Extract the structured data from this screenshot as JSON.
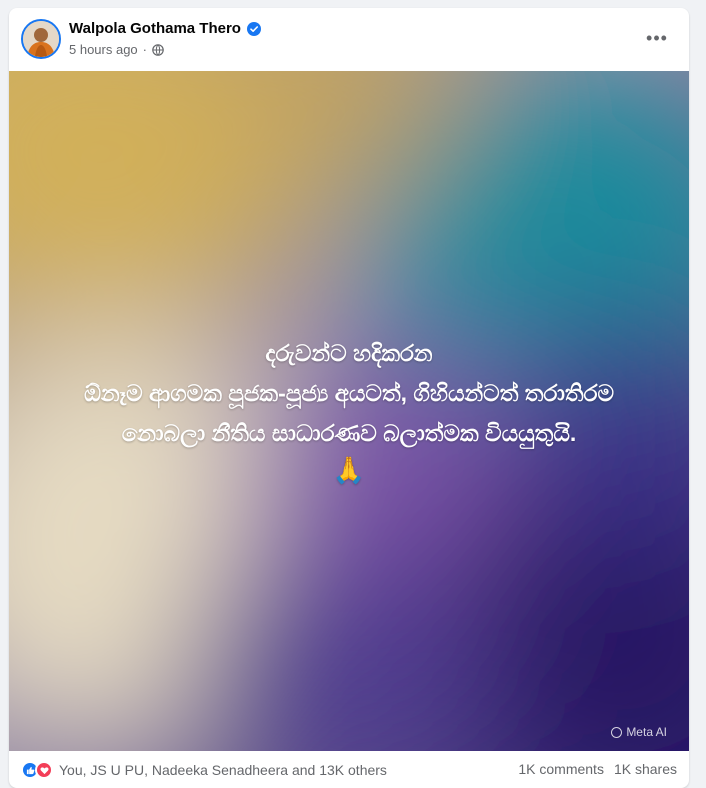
{
  "post": {
    "author_name": "Walpola Gothama Thero",
    "timestamp": "5 hours ago",
    "separator": "·",
    "more_label": "•••",
    "icons": {
      "verified": "verified-badge-icon",
      "audience": "globe-icon",
      "more": "more-options-icon"
    },
    "colors": {
      "verified": "#1877f2",
      "meta_text": "#65676b",
      "name_text": "#050505"
    }
  },
  "image": {
    "lines": [
      "දරුවන්ට හදිකරන",
      "ඕනෑම ආගමක පූජක-පූජ්‍ය අයටත්, ගිහියන්ටත් තරාතිරම",
      "නොබලා නීතිය සාධාරණව බලාත්මක වියයුතුයි."
    ],
    "emoji": "🙏",
    "watermark": "Meta AI",
    "gradient_colors": [
      "#c9ad6e",
      "#1e8f9e",
      "#6b3fa0",
      "#2a1a6e",
      "#e0d0b8"
    ]
  },
  "footer": {
    "reactions_text": "You, JS U PU, Nadeeka Senadheera and 13K others",
    "comments": "1K comments",
    "shares": "1K shares",
    "reaction_icons": [
      "like-icon",
      "love-icon"
    ]
  }
}
